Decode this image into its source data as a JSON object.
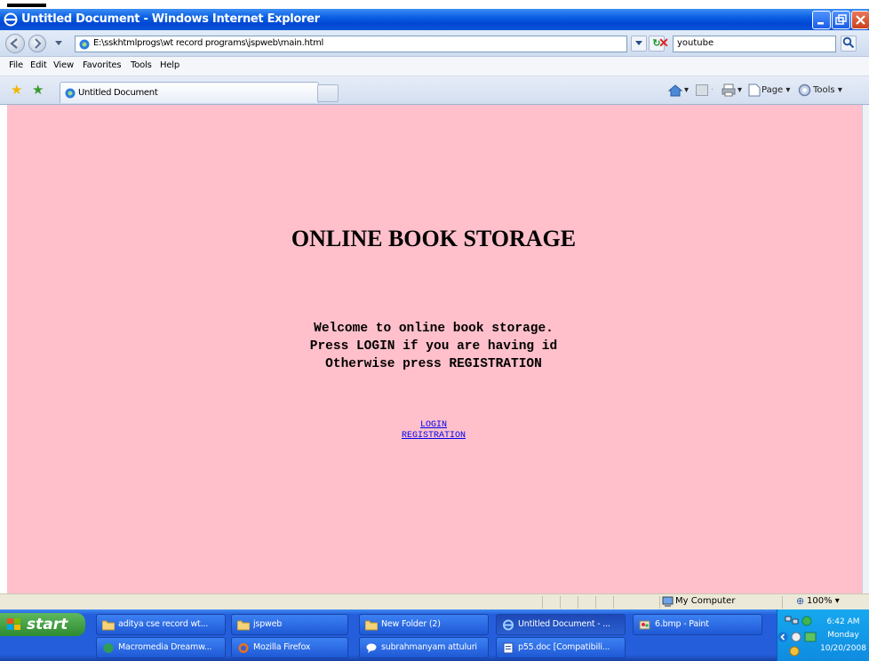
{
  "window": {
    "title": "Untitled Document - Windows Internet Explorer"
  },
  "address_bar": {
    "url": "E:\\sskhtmlprogs\\wt record programs\\jspweb\\main.html",
    "search_value": "youtube"
  },
  "menu": {
    "items": [
      "File",
      "Edit",
      "View",
      "Favorites",
      "Tools",
      "Help"
    ]
  },
  "tabs": {
    "active_label": "Untitled Document"
  },
  "command_bar": {
    "page_label": "Page",
    "tools_label": "Tools"
  },
  "page": {
    "heading": "ONLINE BOOK STORAGE",
    "welcome_lines": [
      "Welcome to online book storage.",
      "Press LOGIN if you are having id",
      "Otherwise press REGISTRATION"
    ],
    "login_link": "LOGIN",
    "registration_link": "REGISTRATION"
  },
  "status_bar": {
    "zone": "My Computer",
    "zoom": "100%"
  },
  "taskbar": {
    "start_label": "start",
    "top_row": [
      "aditya cse record wt...",
      "jspweb",
      "New Folder (2)",
      "Untitled Document - ...",
      "6.bmp - Paint"
    ],
    "bottom_row": [
      "Macromedia Dreamw...",
      "Mozilla Firefox",
      "subrahmanyam attuluri",
      "p55.doc [Compatibili..."
    ],
    "clock_time": "6:42 AM",
    "clock_day": "Monday",
    "clock_date": "10/20/2008"
  },
  "colors": {
    "page_background": "#ffc0cb",
    "titlebar_blue": "#0a5fe0",
    "link": "#0000ee"
  }
}
